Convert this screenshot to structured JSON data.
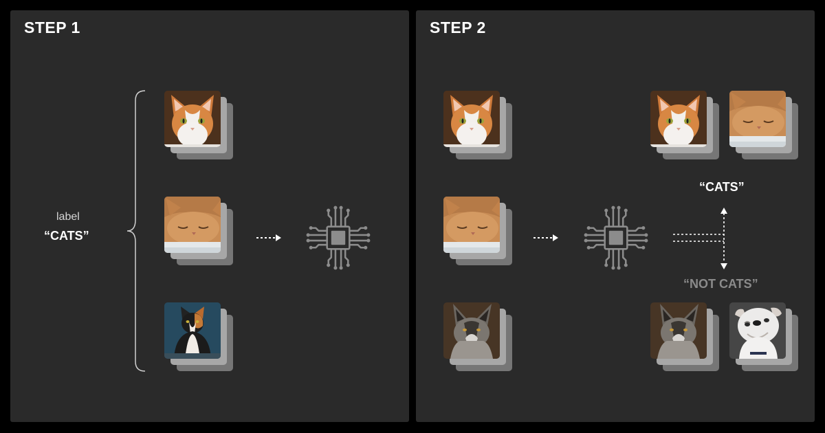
{
  "step1": {
    "title": "STEP 1",
    "label_caption": "label",
    "label_value": "“CATS”",
    "images": [
      {
        "icon": "orange-white-cat-photo"
      },
      {
        "icon": "sleeping-ginger-cat-photo"
      },
      {
        "icon": "calico-cat-photo"
      }
    ]
  },
  "step2": {
    "title": "STEP 2",
    "input_images": [
      {
        "icon": "orange-white-cat-photo"
      },
      {
        "icon": "sleeping-ginger-cat-photo"
      },
      {
        "icon": "wolf-dog-photo"
      }
    ],
    "output_cats_label": "“CATS”",
    "output_not_cats_label": "“NOT CATS”",
    "cats_images": [
      {
        "icon": "orange-white-cat-photo"
      },
      {
        "icon": "sleeping-ginger-cat-photo"
      }
    ],
    "not_cats_images": [
      {
        "icon": "wolf-dog-photo"
      },
      {
        "icon": "bulldog-photo"
      }
    ]
  },
  "colors": {
    "panel_bg": "#2a2a2a",
    "page_bg": "#000000",
    "chip": "#8c8c8c",
    "arrow": "#ffffff",
    "muted_text": "#8a8a8a"
  }
}
